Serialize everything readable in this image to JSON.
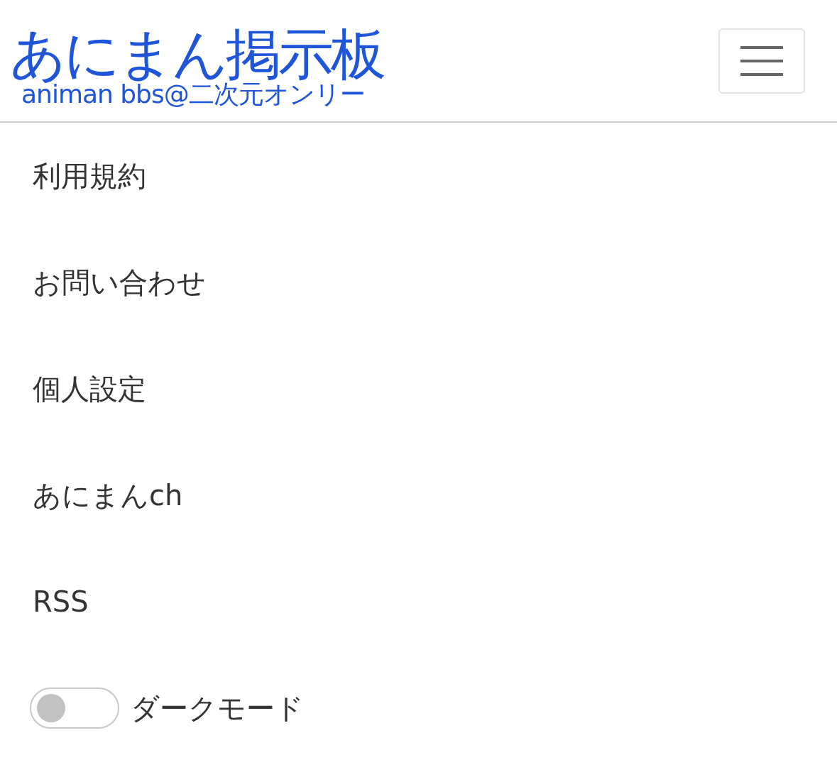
{
  "header": {
    "logo_title": "あにまん掲示板",
    "logo_subtitle": "animan bbs@二次元オンリー"
  },
  "menu": [
    {
      "kind": "link",
      "label": "利用規約"
    },
    {
      "kind": "link",
      "label": "お問い合わせ"
    },
    {
      "kind": "link",
      "label": "個人設定"
    },
    {
      "kind": "link",
      "label": "あにまんch"
    },
    {
      "kind": "link",
      "label": "RSS"
    },
    {
      "kind": "switch",
      "label": "ダークモード",
      "on": false
    }
  ]
}
